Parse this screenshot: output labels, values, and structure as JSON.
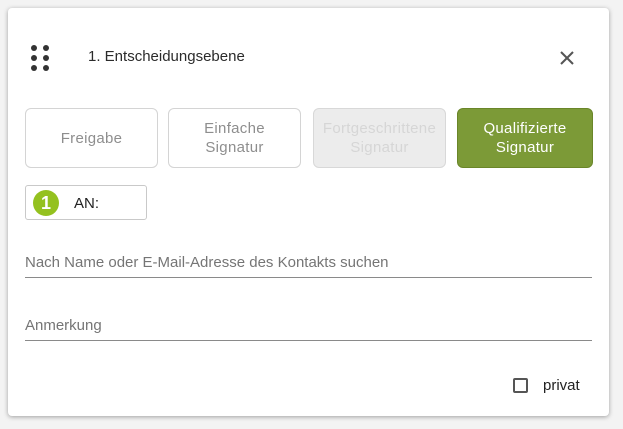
{
  "dialog": {
    "title": "1. Entscheidungsebene",
    "close_icon": "close-icon",
    "drag_icon": "drag-handle-icon"
  },
  "signature_types": [
    {
      "label": "Freigabe",
      "state": "default"
    },
    {
      "label": "Einfache\nSignatur",
      "state": "default"
    },
    {
      "label": "Fortgeschrittene\nSignatur",
      "state": "disabled"
    },
    {
      "label": "Qualifizierte\nSignatur",
      "state": "selected"
    }
  ],
  "recipient": {
    "step_number": "1",
    "label": "AN:"
  },
  "search": {
    "placeholder": "Nach Name oder E-Mail-Adresse des Kontakts suchen",
    "value": ""
  },
  "note": {
    "placeholder": "Anmerkung",
    "value": ""
  },
  "private": {
    "label": "privat",
    "checked": false
  },
  "colors": {
    "accent": "#7c9a37",
    "step_badge": "#94c11f"
  }
}
